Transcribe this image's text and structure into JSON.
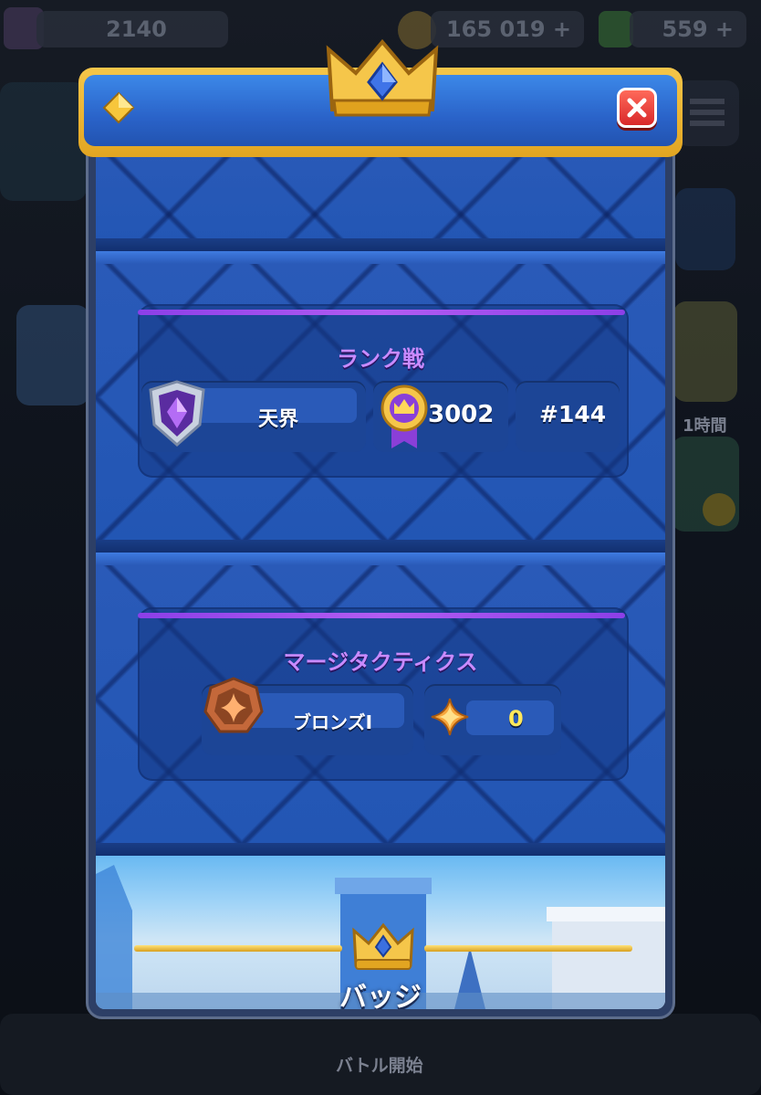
{
  "hud": {
    "trophies": "2140",
    "gold": "165 019 +",
    "gems": "559 +"
  },
  "background": {
    "timer_label": "1時間",
    "battle_button_label": "バトル開始"
  },
  "modal": {
    "ranked": {
      "title": "ランク戦",
      "league_name": "天界",
      "rating": "3002",
      "rank": "#144"
    },
    "merge_tactics": {
      "title": "マージタクティクス",
      "league_name": "ブロンズI",
      "points": "0"
    },
    "footer_label": "バッジ"
  },
  "colors": {
    "section_title": "#c98bff",
    "panel_blue": "#2256b4",
    "header_gold": "#f5c64a",
    "close_red": "#d9282a"
  }
}
